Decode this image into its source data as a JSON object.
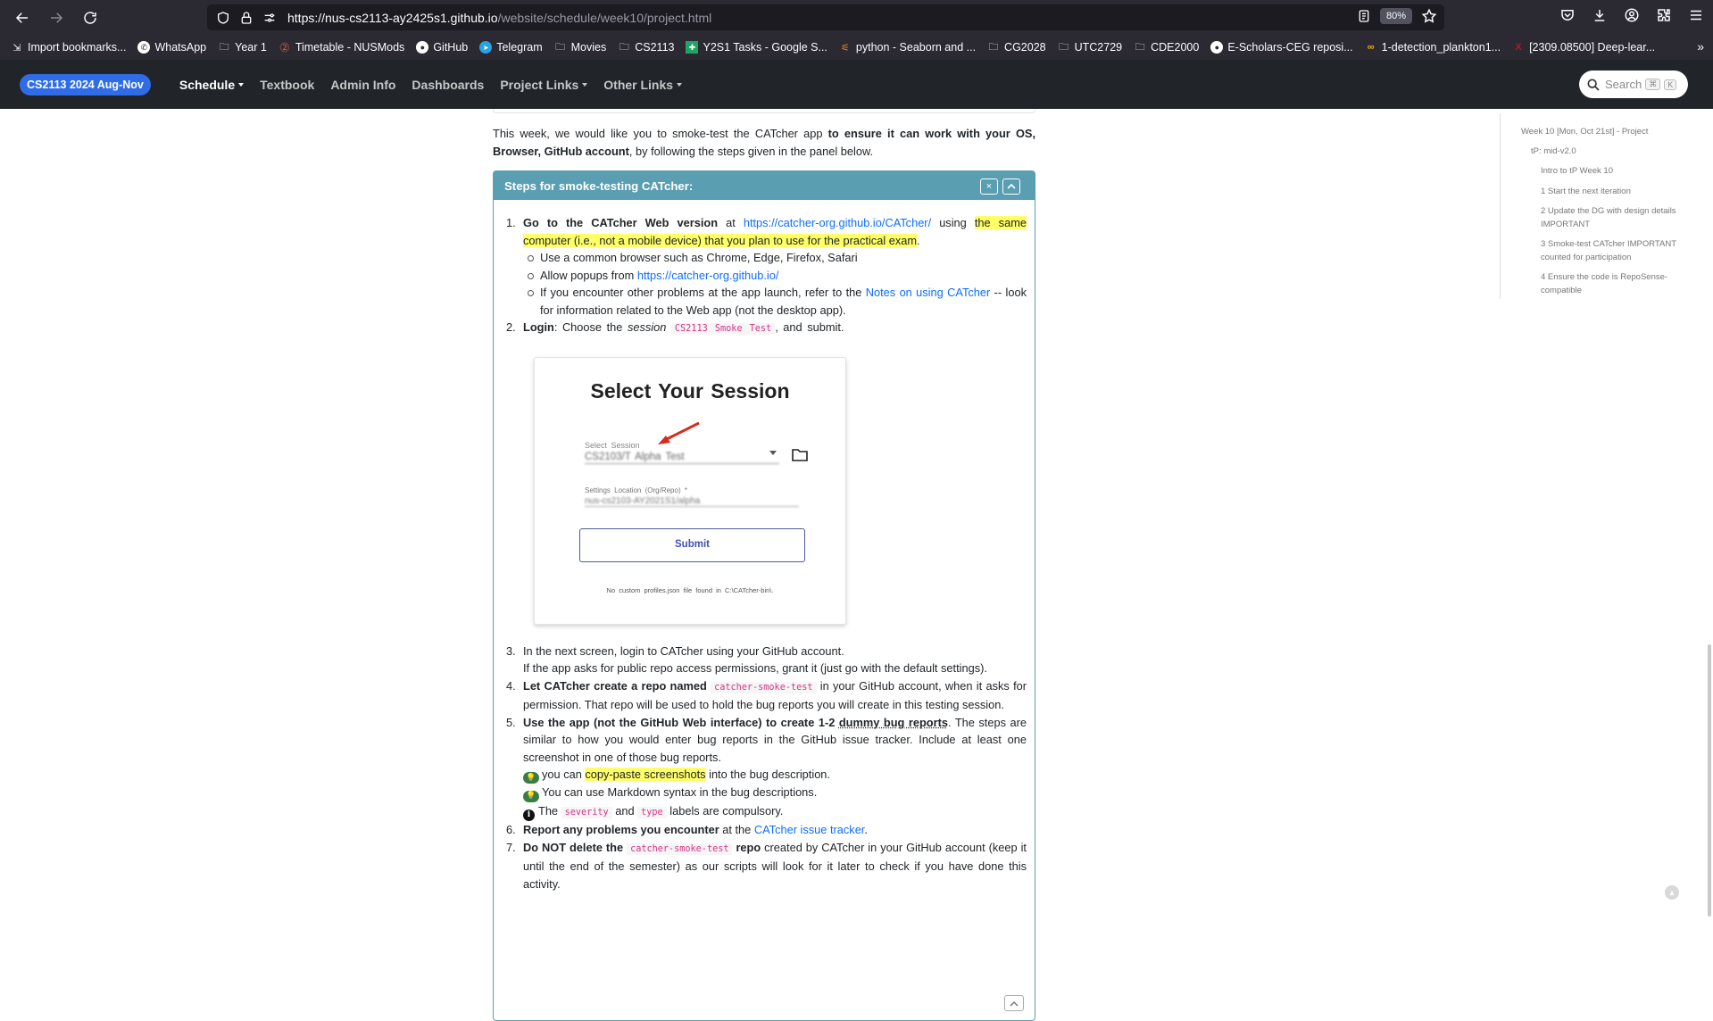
{
  "browser": {
    "url_host": "https://nus-cs2113-ay2425s1.github.io",
    "url_path": "/website/schedule/week10/project.html",
    "zoom": "80%"
  },
  "bookmarks": [
    {
      "label": "Import bookmarks...",
      "icon": "import-icon"
    },
    {
      "label": "WhatsApp",
      "icon": "whatsapp-icon"
    },
    {
      "label": "Year 1",
      "icon": "folder-icon"
    },
    {
      "label": "Timetable - NUSMods",
      "icon": "nusmods-icon"
    },
    {
      "label": "GitHub",
      "icon": "github-icon"
    },
    {
      "label": "Telegram",
      "icon": "telegram-icon"
    },
    {
      "label": "Movies",
      "icon": "folder-icon"
    },
    {
      "label": "CS2113",
      "icon": "folder-icon"
    },
    {
      "label": "Y2S1 Tasks - Google S...",
      "icon": "sheets-icon"
    },
    {
      "label": "python - Seaborn and ...",
      "icon": "stackoverflow-icon"
    },
    {
      "label": "CG2028",
      "icon": "folder-icon"
    },
    {
      "label": "UTC2729",
      "icon": "folder-icon"
    },
    {
      "label": "CDE2000",
      "icon": "folder-icon"
    },
    {
      "label": "E-Scholars-CEG reposi...",
      "icon": "github-icon"
    },
    {
      "label": "1-detection_plankton1...",
      "icon": "colab-icon"
    },
    {
      "label": "[2309.08500] Deep-lear...",
      "icon": "arxiv-icon"
    }
  ],
  "site_nav": {
    "brand": "CS2113 2024 Aug-Nov",
    "links": [
      "Schedule",
      "Textbook",
      "Admin Info",
      "Dashboards",
      "Project Links",
      "Other Links"
    ],
    "search_placeholder": "Search",
    "search_kbd": [
      "⌘",
      "K"
    ]
  },
  "intro": {
    "pre": "This week, we would like you to smoke-test the CATcher app ",
    "bold": "to ensure it can work with your OS, Browser, GitHub account",
    "post": ", by following the steps given in the panel below."
  },
  "panel": {
    "title": "Steps for smoke-testing CATcher:",
    "close_glyph": "×",
    "collapse_glyph": "^",
    "steps": {
      "s1": {
        "num": "1.",
        "bold": "Go to the CATcher Web version",
        "at": " at ",
        "link": "https://catcher-org.github.io/CATcher/",
        "using": " using ",
        "highlight": "the same computer (i.e., not a mobile device) that you plan to use for the practical exam",
        "end": ".",
        "sub1": "Use a common browser such as Chrome, Edge, Firefox, Safari",
        "sub2_pre": "Allow popups from ",
        "sub2_link": "https://catcher-org.github.io/",
        "sub3_pre": "If you encounter other problems at the app launch, refer to the ",
        "sub3_link": "Notes on using CATcher",
        "sub3_post": " -- look for information related to the Web app (not the desktop app)."
      },
      "s2": {
        "num": "2.",
        "bold": "Login",
        "text1": ": Choose the ",
        "italic": "session",
        "code": "CS2113 Smoke Test",
        "text2": ", and submit."
      },
      "s3": {
        "num": "3.",
        "line1": "In the next screen, login to CATcher using your GitHub account.",
        "line2": "If the app asks for public repo access permissions, grant it (just go with the default settings)."
      },
      "s4": {
        "num": "4.",
        "bold": "Let CATcher create a repo named ",
        "code": "catcher-smoke-test",
        "text": " in your GitHub account, when it asks for permission. That repo will be used to hold the bug reports you will create in this testing session."
      },
      "s5": {
        "num": "5.",
        "bold1": "Use the app (not the GitHub Web interface) to create 1-2 ",
        "bold2": "dummy bug reports",
        "text": ". The steps are similar to how you would enter bug reports in the GitHub issue tracker. Include at least one screenshot in one of those bug reports.",
        "tip1_pre": "you can ",
        "tip1_hl": "copy-paste screenshots",
        "tip1_post": " into the bug description.",
        "tip2": "You can use Markdown syntax in the bug descriptions.",
        "info_pre": "The ",
        "info_code1": "severity",
        "info_mid": " and ",
        "info_code2": "type",
        "info_post": " labels are compulsory."
      },
      "s6": {
        "num": "6.",
        "bold": "Report any problems you encounter",
        "text": " at the ",
        "link": "CATcher issue tracker",
        "end": "."
      },
      "s7": {
        "num": "7.",
        "bold1": "Do NOT delete the ",
        "code": "catcher-smoke-test",
        "bold2": " repo",
        "text": " created by CATcher in your GitHub account (keep it until the end of the semester) as our scripts will look for it later to check if you have done this activity."
      }
    },
    "screenshot": {
      "title": "Select Your Session",
      "select_label": "Select Session",
      "select_value": "CS2103/T Alpha Test",
      "loc_label": "Settings Location (Org/Repo) *",
      "loc_value": "nus-cs2103-AY2021S1/alpha",
      "submit": "Submit",
      "footnote": "No custom profiles.json file found in C:\\CATcher-bin\\."
    }
  },
  "toc": [
    "Week 10 [Mon, Oct 21st] - Project",
    "tP: mid-v2.0",
    "Intro to tP Week 10",
    "1 Start the next iteration",
    "2 Update the DG with design details IMPORTANT",
    "3 Smoke-test CATcher IMPORTANT counted for participation",
    "4 Ensure the code is RepoSense-compatible"
  ]
}
